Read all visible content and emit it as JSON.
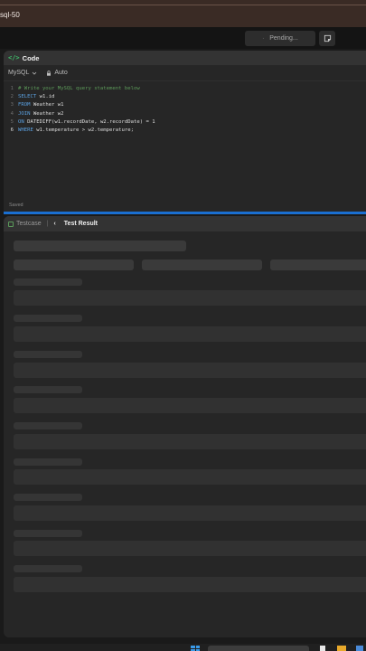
{
  "browser": {
    "tab_title": "sql-50"
  },
  "toolbar": {
    "pending_label": "Pending..."
  },
  "code_panel": {
    "title": "Code",
    "language": "MySQL",
    "mode": "Auto",
    "status": "Saved",
    "lines": [
      {
        "n": "1",
        "tokens": [
          {
            "t": "comment",
            "v": "# Write your MySQL query statement below"
          }
        ]
      },
      {
        "n": "2",
        "tokens": [
          {
            "t": "kw",
            "v": "SELECT"
          },
          {
            "t": "txt",
            "v": " w1.id"
          }
        ]
      },
      {
        "n": "3",
        "tokens": [
          {
            "t": "kw",
            "v": "FROM"
          },
          {
            "t": "txt",
            "v": " Weather w1"
          }
        ]
      },
      {
        "n": "4",
        "tokens": [
          {
            "t": "kw",
            "v": "JOIN"
          },
          {
            "t": "txt",
            "v": " Weather w2"
          }
        ]
      },
      {
        "n": "5",
        "tokens": [
          {
            "t": "kw",
            "v": "ON"
          },
          {
            "t": "txt",
            "v": " DATEDIFF(w1.recordDate, w2.recordDate) = 1"
          }
        ]
      },
      {
        "n": "6",
        "tokens": [
          {
            "t": "kw",
            "v": "WHERE"
          },
          {
            "t": "txt",
            "v": " w1.temperature > w2.temperature;"
          }
        ]
      }
    ]
  },
  "result_panel": {
    "tab_testcase": "Testcase",
    "tab_result": "Test Result",
    "state": "loading"
  },
  "icons": {
    "code": "code-icon",
    "chevron": "chevron-down-icon",
    "lock": "lock-icon",
    "note": "note-icon",
    "spinner": "spinner-icon"
  },
  "colors": {
    "accent": "#1a6fd1",
    "code_green": "#3fbf6b",
    "keyword": "#5aa0e0",
    "comment": "#5d9b5a"
  }
}
